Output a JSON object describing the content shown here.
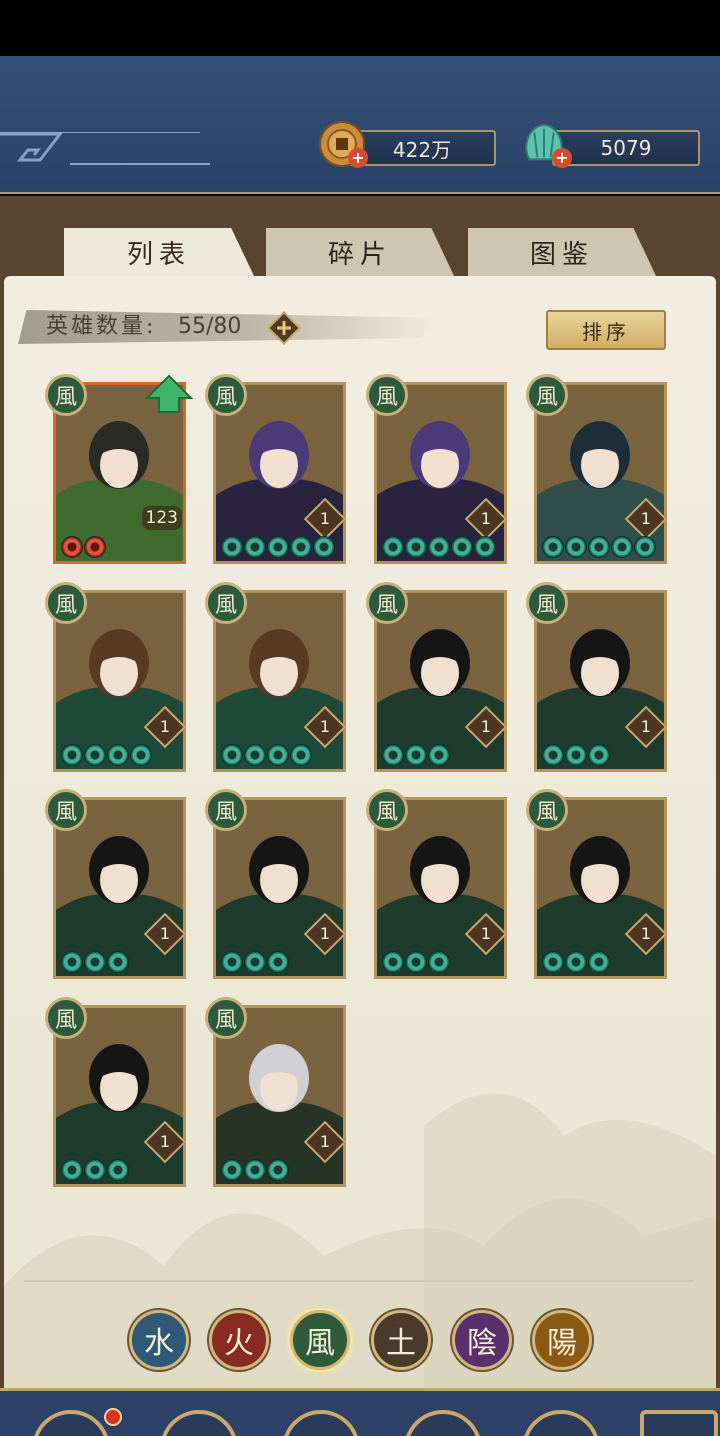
{
  "currencies": {
    "copper": {
      "amount": "422万",
      "icon": "copper-coin-icon"
    },
    "jade": {
      "amount": "5079",
      "icon": "jade-shell-icon"
    }
  },
  "tabs": [
    {
      "label": "列表",
      "active": true
    },
    {
      "label": "碎片",
      "active": false
    },
    {
      "label": "图鉴",
      "active": false
    }
  ],
  "hero_count": {
    "label": "英雄数量:",
    "value": "55/80"
  },
  "sort_label": "排序",
  "element_glyphs": {
    "wind": "風",
    "water": "水",
    "fire": "火",
    "earth": "土",
    "yin": "陰",
    "yang": "陽"
  },
  "cards": [
    {
      "element": "風",
      "level": "123",
      "stars": 2,
      "star_color": "red",
      "legend": true,
      "upgrade": true,
      "hair": "#2a2a26",
      "robe": "#3f6b2e"
    },
    {
      "element": "風",
      "level": "1",
      "stars": 5,
      "star_color": "green",
      "legend": false,
      "upgrade": false,
      "hair": "#4b3a78",
      "robe": "#2a2340"
    },
    {
      "element": "風",
      "level": "1",
      "stars": 5,
      "star_color": "green",
      "legend": false,
      "upgrade": false,
      "hair": "#4b3a78",
      "robe": "#2a2340"
    },
    {
      "element": "風",
      "level": "1",
      "stars": 5,
      "star_color": "green",
      "legend": false,
      "upgrade": false,
      "hair": "#1d2d3a",
      "robe": "#2f4e4c"
    },
    {
      "element": "風",
      "level": "1",
      "stars": 4,
      "star_color": "green",
      "legend": false,
      "upgrade": false,
      "hair": "#5a3b22",
      "robe": "#1f4a3a"
    },
    {
      "element": "風",
      "level": "1",
      "stars": 4,
      "star_color": "green",
      "legend": false,
      "upgrade": false,
      "hair": "#5a3b22",
      "robe": "#1f4a3a"
    },
    {
      "element": "風",
      "level": "1",
      "stars": 3,
      "star_color": "green",
      "legend": false,
      "upgrade": false,
      "hair": "#161616",
      "robe": "#1f3b2e"
    },
    {
      "element": "風",
      "level": "1",
      "stars": 3,
      "star_color": "green",
      "legend": false,
      "upgrade": false,
      "hair": "#161616",
      "robe": "#1f3b2e"
    },
    {
      "element": "風",
      "level": "1",
      "stars": 3,
      "star_color": "green",
      "legend": false,
      "upgrade": false,
      "hair": "#161616",
      "robe": "#1f3b2e"
    },
    {
      "element": "風",
      "level": "1",
      "stars": 3,
      "star_color": "green",
      "legend": false,
      "upgrade": false,
      "hair": "#161616",
      "robe": "#1f3b2e"
    },
    {
      "element": "風",
      "level": "1",
      "stars": 3,
      "star_color": "green",
      "legend": false,
      "upgrade": false,
      "hair": "#161616",
      "robe": "#1f3b2e"
    },
    {
      "element": "風",
      "level": "1",
      "stars": 3,
      "star_color": "green",
      "legend": false,
      "upgrade": false,
      "hair": "#161616",
      "robe": "#1f3b2e"
    },
    {
      "element": "風",
      "level": "1",
      "stars": 3,
      "star_color": "green",
      "legend": false,
      "upgrade": false,
      "hair": "#161616",
      "robe": "#1f3b2e"
    },
    {
      "element": "風",
      "level": "1",
      "stars": 3,
      "star_color": "green",
      "legend": false,
      "upgrade": false,
      "hair": "#d0d0d4",
      "robe": "#263325"
    }
  ],
  "element_filters": [
    {
      "glyph": "水",
      "color": "#2e5a77",
      "selected": false,
      "name": "water"
    },
    {
      "glyph": "火",
      "color": "#8a2b22",
      "selected": false,
      "name": "fire"
    },
    {
      "glyph": "風",
      "color": "#2e5b3a",
      "selected": true,
      "name": "wind"
    },
    {
      "glyph": "土",
      "color": "#4b3a2c",
      "selected": false,
      "name": "earth"
    },
    {
      "glyph": "陰",
      "color": "#5a2f6e",
      "selected": false,
      "name": "yin"
    },
    {
      "glyph": "陽",
      "color": "#8a5a12",
      "selected": false,
      "name": "yang"
    }
  ],
  "colors": {
    "accent_gold": "#c9a86a",
    "header_blue": "#2b4267",
    "panel_paper": "#f2ede0"
  }
}
